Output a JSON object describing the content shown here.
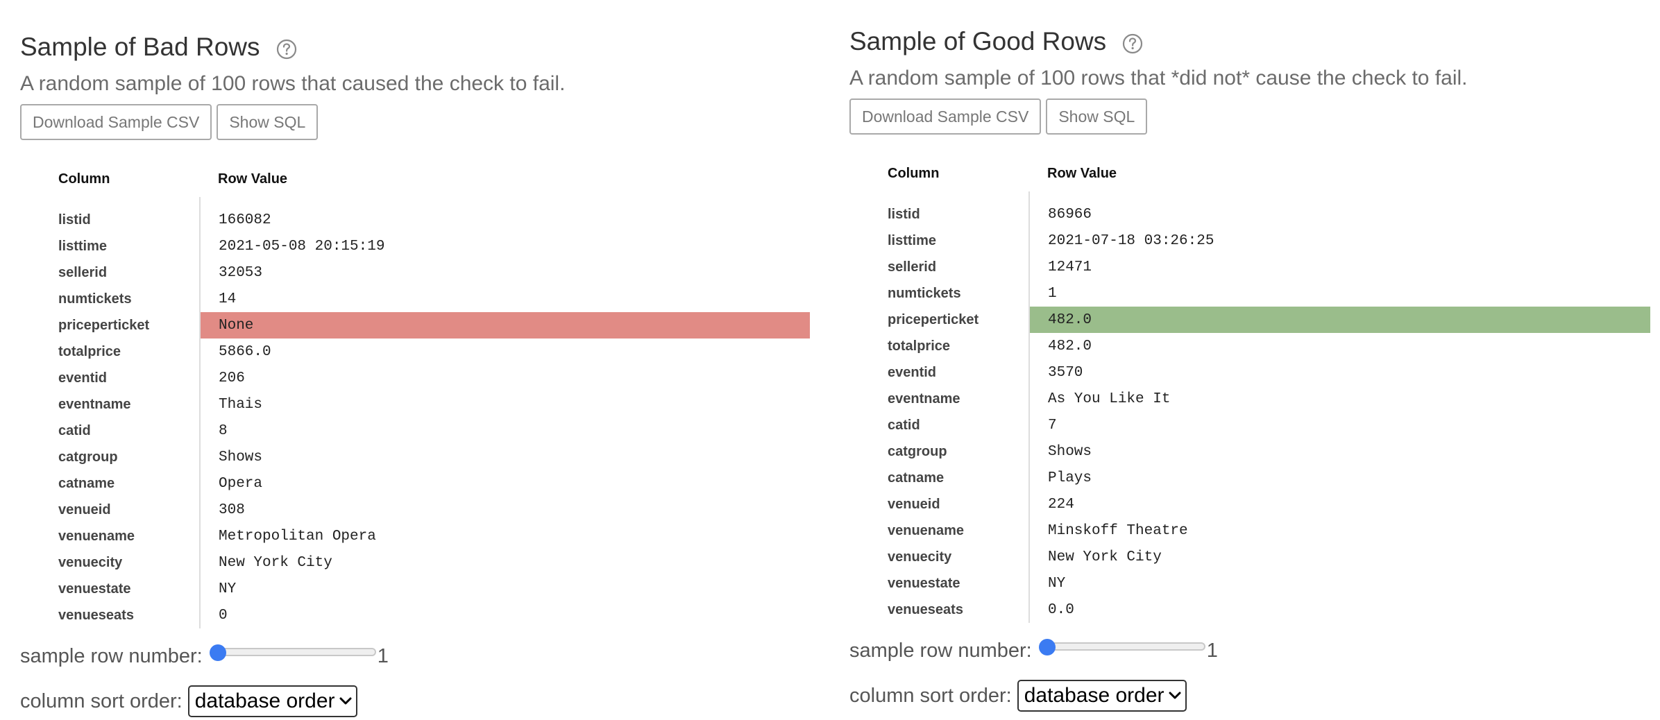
{
  "panels": {
    "bad": {
      "title": "Sample of Bad Rows",
      "description": "A random sample of 100 rows that caused the check to fail.",
      "download_label": "Download Sample CSV",
      "sql_label": "Show SQL",
      "headers": {
        "column": "Column",
        "value": "Row Value"
      },
      "rows": [
        {
          "name": "listid",
          "value": "166082"
        },
        {
          "name": "listtime",
          "value": "2021-05-08 20:15:19"
        },
        {
          "name": "sellerid",
          "value": "32053"
        },
        {
          "name": "numtickets",
          "value": "14"
        },
        {
          "name": "priceperticket",
          "value": "None"
        },
        {
          "name": "totalprice",
          "value": "5866.0"
        },
        {
          "name": "eventid",
          "value": "206"
        },
        {
          "name": "eventname",
          "value": "Thais"
        },
        {
          "name": "catid",
          "value": "8"
        },
        {
          "name": "catgroup",
          "value": "Shows"
        },
        {
          "name": "catname",
          "value": "Opera"
        },
        {
          "name": "venueid",
          "value": "308"
        },
        {
          "name": "venuename",
          "value": "Metropolitan Opera"
        },
        {
          "name": "venuecity",
          "value": "New York City"
        },
        {
          "name": "venuestate",
          "value": "NY"
        },
        {
          "name": "venueseats",
          "value": "0"
        }
      ],
      "highlight_color": "#e18b85",
      "sample_row_label": "sample row number:",
      "sample_row_value": "1",
      "sort_label": "column sort order:",
      "sort_selected": "database order"
    },
    "good": {
      "title": "Sample of Good Rows",
      "description": "A random sample of 100 rows that *did not* cause the check to fail.",
      "download_label": "Download Sample CSV",
      "sql_label": "Show SQL",
      "headers": {
        "column": "Column",
        "value": "Row Value"
      },
      "rows": [
        {
          "name": "listid",
          "value": "86966"
        },
        {
          "name": "listtime",
          "value": "2021-07-18 03:26:25"
        },
        {
          "name": "sellerid",
          "value": "12471"
        },
        {
          "name": "numtickets",
          "value": "1"
        },
        {
          "name": "priceperticket",
          "value": "482.0"
        },
        {
          "name": "totalprice",
          "value": "482.0"
        },
        {
          "name": "eventid",
          "value": "3570"
        },
        {
          "name": "eventname",
          "value": "As You Like It"
        },
        {
          "name": "catid",
          "value": "7"
        },
        {
          "name": "catgroup",
          "value": "Shows"
        },
        {
          "name": "catname",
          "value": "Plays"
        },
        {
          "name": "venueid",
          "value": "224"
        },
        {
          "name": "venuename",
          "value": "Minskoff Theatre"
        },
        {
          "name": "venuecity",
          "value": "New York City"
        },
        {
          "name": "venuestate",
          "value": "NY"
        },
        {
          "name": "venueseats",
          "value": "0.0"
        }
      ],
      "highlight_color": "#9abd8b",
      "sample_row_label": "sample row number:",
      "sample_row_value": "1",
      "sort_label": "column sort order:",
      "sort_selected": "database order"
    }
  },
  "colors": {
    "accent": "#3b7bf2"
  }
}
